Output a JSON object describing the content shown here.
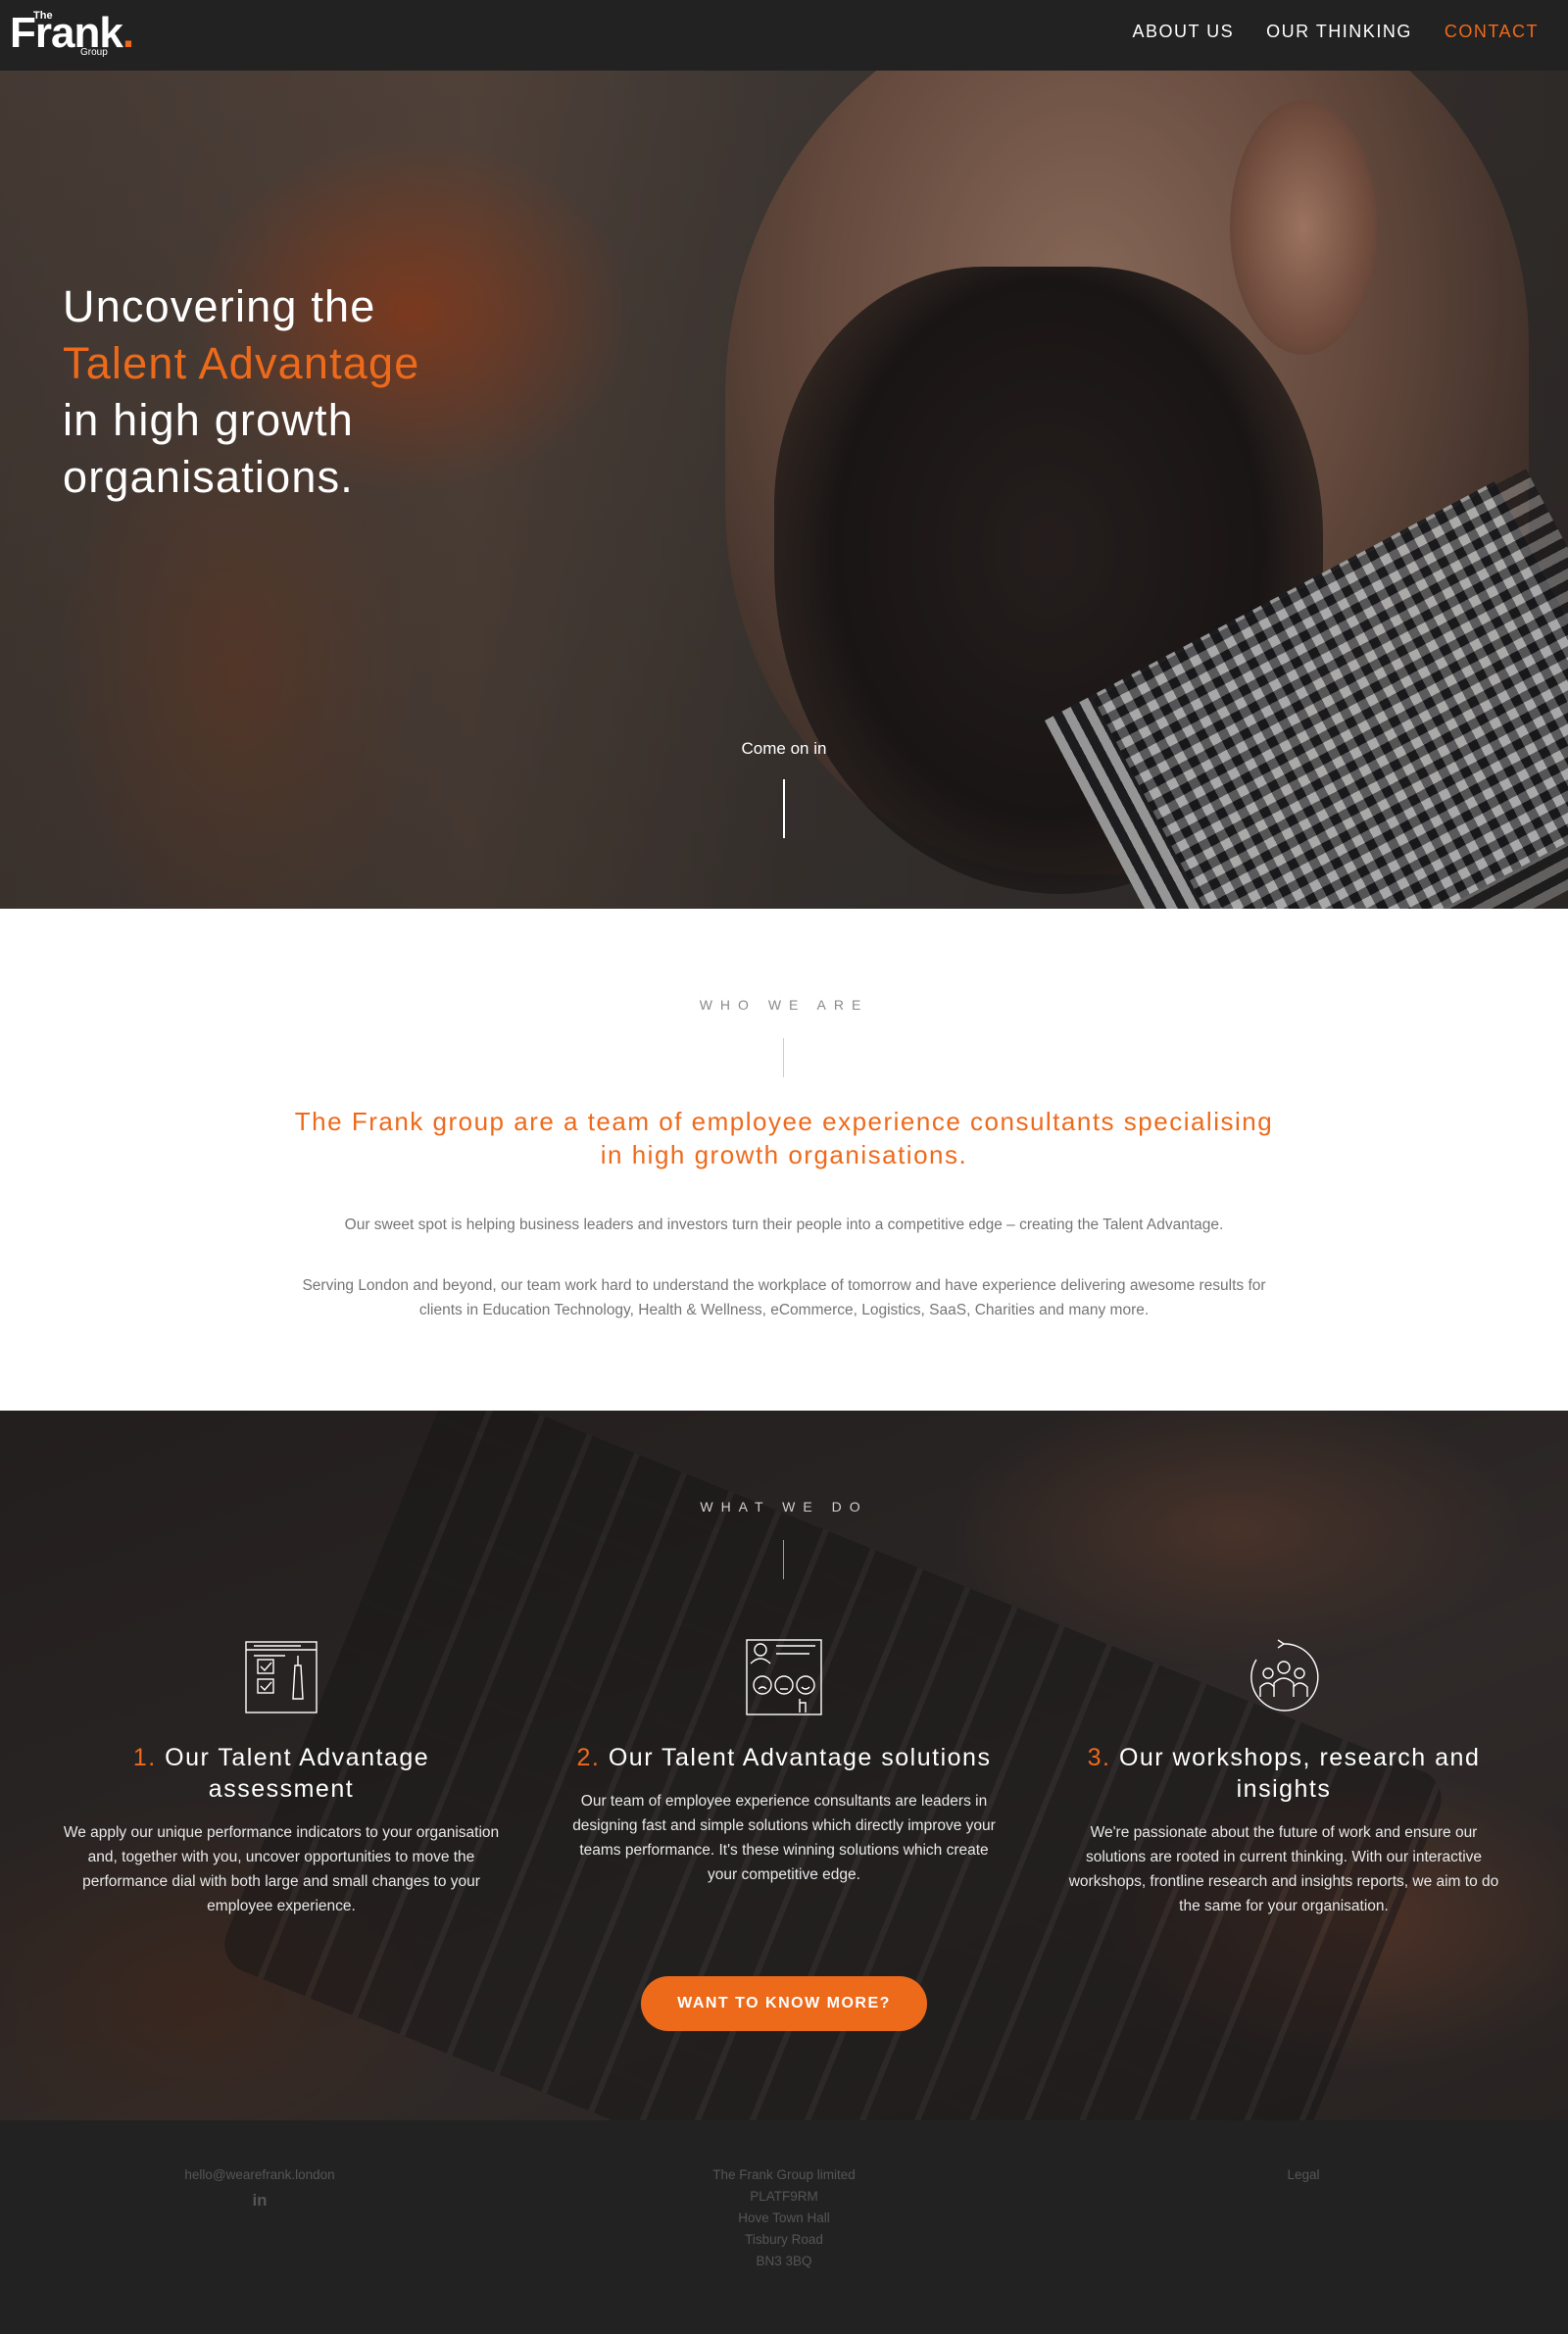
{
  "nav": {
    "logo": {
      "the": "The",
      "frank": "Frank",
      "dot": ".",
      "group": "Group"
    },
    "items": [
      {
        "label": "ABOUT US"
      },
      {
        "label": "OUR THINKING"
      },
      {
        "label": "CONTACT"
      }
    ],
    "accent_color": "#ee6a1b",
    "background_color": "#222222"
  },
  "hero": {
    "line1": "Uncovering the",
    "line2": "Talent Advantage",
    "line3": "in high growth",
    "line4": "organisations.",
    "scroll_label": "Come on in"
  },
  "who": {
    "eyebrow": "WHO WE ARE",
    "lead": "The Frank group are a team of employee experience consultants specialising in high growth organisations.",
    "p1": "Our sweet spot is helping business leaders and investors turn their people into a competitive edge – creating the Talent Advantage.",
    "p2": "Serving London and beyond, our team work hard to understand the workplace of tomorrow and have experience delivering awesome results for clients in Education Technology, Health & Wellness, eCommerce, Logistics, SaaS, Charities and many more."
  },
  "what": {
    "eyebrow": "WHAT WE DO",
    "columns": [
      {
        "num": "1.",
        "title": "Our Talent Advantage assessment",
        "icon": "checklist-icon",
        "text": "We apply our unique performance indicators to your organisation and, together with you, uncover opportunities to move the performance dial with both large and small changes to your employee experience."
      },
      {
        "num": "2.",
        "title": "Our Talent Advantage solutions",
        "icon": "feedback-faces-icon",
        "text": "Our team of employee experience consultants are leaders in designing fast and simple solutions which directly improve your teams performance. It's these winning solutions which create your competitive edge."
      },
      {
        "num": "3.",
        "title": "Our workshops, research and insights",
        "icon": "team-cycle-icon",
        "text": "We're passionate about the future of work and ensure our solutions are rooted in current thinking. With our interactive workshops, frontline research and insights reports, we aim to do the same for your organisation."
      }
    ],
    "cta": "WANT TO KNOW MORE?"
  },
  "footer": {
    "email": "hello@wearefrank.london",
    "linkedin_icon": "linkedin-icon",
    "company": "The Frank Group limited",
    "address": [
      "PLATF9RM",
      "Hove Town Hall",
      "Tisbury Road",
      "BN3 3BQ"
    ],
    "legal": "Legal"
  }
}
